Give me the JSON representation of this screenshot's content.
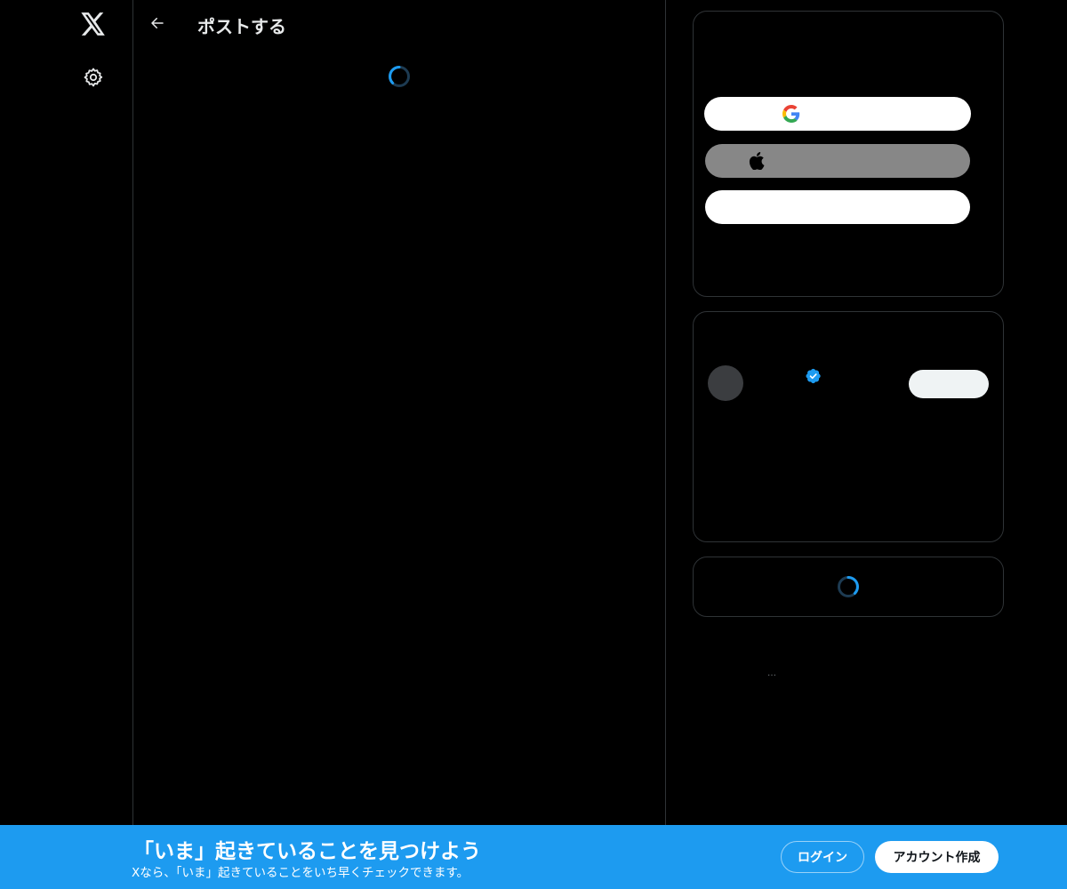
{
  "header": {
    "title": "ポストする"
  },
  "banner": {
    "title": "「いま」起きていることを見つけよう",
    "subtitle": "Xなら、「いま」起きていることをいち早くチェックできます。",
    "login_label": "ログイン",
    "signup_label": "アカウント作成"
  },
  "sidebar": {
    "more_label": "…"
  },
  "icons": {
    "logo": "x-logo-icon",
    "settings": "gear-icon",
    "back": "arrow-left-icon",
    "google": "google-icon",
    "apple": "apple-icon",
    "verified": "verified-badge-icon",
    "loading": "spinner-icon"
  },
  "colors": {
    "background": "#000000",
    "accent": "#1d9bf0",
    "border": "#2f3336",
    "text": "#e7e9ea"
  }
}
